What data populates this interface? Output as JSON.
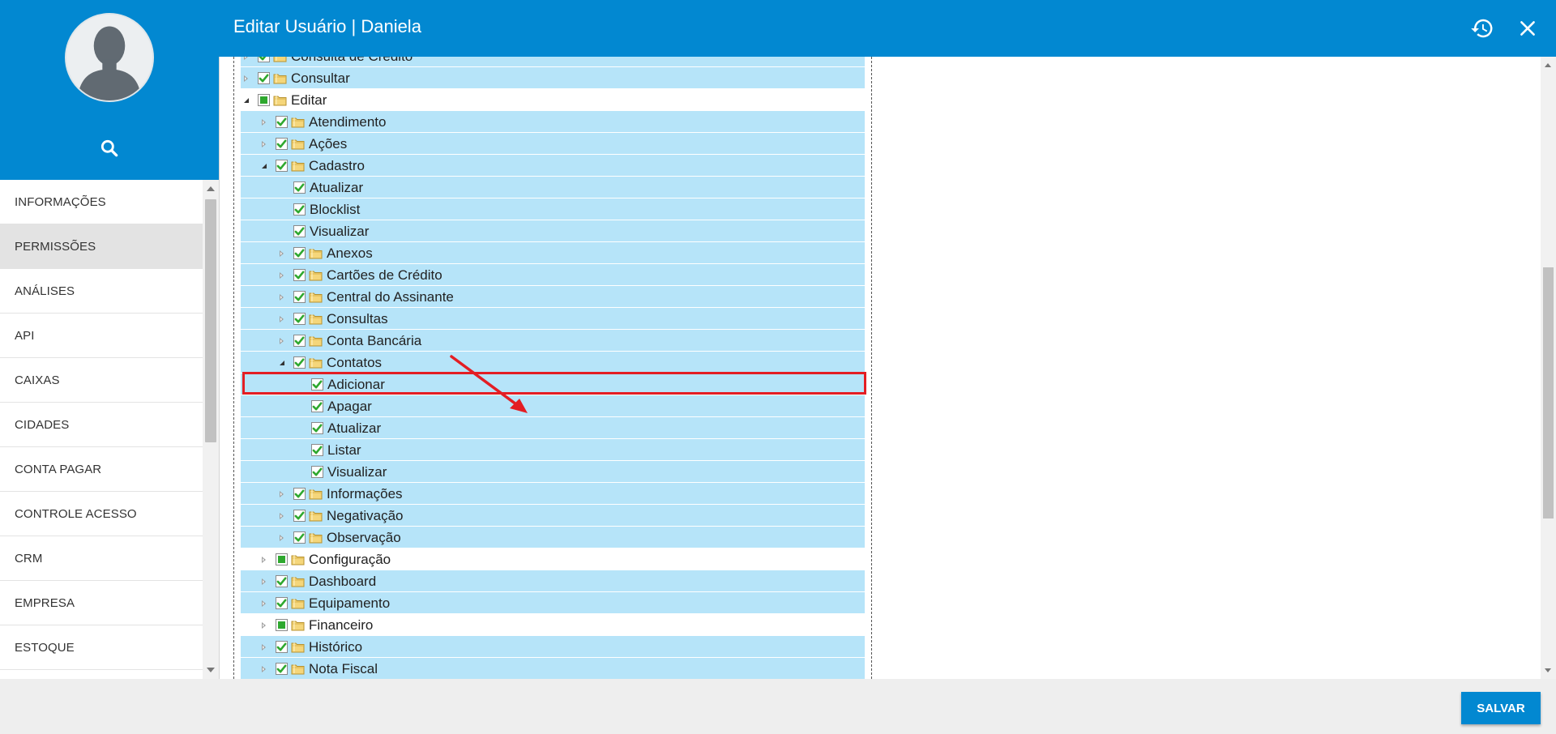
{
  "header": {
    "title": "Editar Usuário | Daniela"
  },
  "sidebar": {
    "items": [
      {
        "label": "INFORMAÇÕES",
        "active": false
      },
      {
        "label": "PERMISSÕES",
        "active": true
      },
      {
        "label": "ANÁLISES",
        "active": false
      },
      {
        "label": "API",
        "active": false
      },
      {
        "label": "CAIXAS",
        "active": false
      },
      {
        "label": "CIDADES",
        "active": false
      },
      {
        "label": "CONTA PAGAR",
        "active": false
      },
      {
        "label": "CONTROLE ACESSO",
        "active": false
      },
      {
        "label": "CRM",
        "active": false
      },
      {
        "label": "EMPRESA",
        "active": false
      },
      {
        "label": "ESTOQUE",
        "active": false
      }
    ]
  },
  "tree": [
    {
      "label": "Consulta de Crédito",
      "level": 1,
      "toggle": "collapsed",
      "check": "checked",
      "folder": true,
      "selected": true
    },
    {
      "label": "Consultar",
      "level": 1,
      "toggle": "collapsed",
      "check": "checked",
      "folder": true,
      "selected": true
    },
    {
      "label": "Editar",
      "level": 1,
      "toggle": "expanded",
      "check": "partial",
      "folder": true,
      "selected": false
    },
    {
      "label": "Atendimento",
      "level": 2,
      "toggle": "collapsed",
      "check": "checked",
      "folder": true,
      "selected": true
    },
    {
      "label": "Ações",
      "level": 2,
      "toggle": "collapsed",
      "check": "checked",
      "folder": true,
      "selected": true
    },
    {
      "label": "Cadastro",
      "level": 2,
      "toggle": "expanded",
      "check": "checked",
      "folder": true,
      "selected": true
    },
    {
      "label": "Atualizar",
      "level": 3,
      "toggle": "none",
      "check": "checked",
      "folder": false,
      "selected": true
    },
    {
      "label": "Blocklist",
      "level": 3,
      "toggle": "none",
      "check": "checked",
      "folder": false,
      "selected": true
    },
    {
      "label": "Visualizar",
      "level": 3,
      "toggle": "none",
      "check": "checked",
      "folder": false,
      "selected": true
    },
    {
      "label": "Anexos",
      "level": 3,
      "toggle": "collapsed",
      "check": "checked",
      "folder": true,
      "selected": true
    },
    {
      "label": "Cartões de Crédito",
      "level": 3,
      "toggle": "collapsed",
      "check": "checked",
      "folder": true,
      "selected": true
    },
    {
      "label": "Central do Assinante",
      "level": 3,
      "toggle": "collapsed",
      "check": "checked",
      "folder": true,
      "selected": true
    },
    {
      "label": "Consultas",
      "level": 3,
      "toggle": "collapsed",
      "check": "checked",
      "folder": true,
      "selected": true
    },
    {
      "label": "Conta Bancária",
      "level": 3,
      "toggle": "collapsed",
      "check": "checked",
      "folder": true,
      "selected": true
    },
    {
      "label": "Contatos",
      "level": 3,
      "toggle": "expanded",
      "check": "checked",
      "folder": true,
      "selected": true
    },
    {
      "label": "Adicionar",
      "level": 4,
      "toggle": "none",
      "check": "checked",
      "folder": false,
      "selected": true,
      "highlighted": true
    },
    {
      "label": "Apagar",
      "level": 4,
      "toggle": "none",
      "check": "checked",
      "folder": false,
      "selected": true
    },
    {
      "label": "Atualizar",
      "level": 4,
      "toggle": "none",
      "check": "checked",
      "folder": false,
      "selected": true
    },
    {
      "label": "Listar",
      "level": 4,
      "toggle": "none",
      "check": "checked",
      "folder": false,
      "selected": true
    },
    {
      "label": "Visualizar",
      "level": 4,
      "toggle": "none",
      "check": "checked",
      "folder": false,
      "selected": true
    },
    {
      "label": "Informações",
      "level": 3,
      "toggle": "collapsed",
      "check": "checked",
      "folder": true,
      "selected": true
    },
    {
      "label": "Negativação",
      "level": 3,
      "toggle": "collapsed",
      "check": "checked",
      "folder": true,
      "selected": true
    },
    {
      "label": "Observação",
      "level": 3,
      "toggle": "collapsed",
      "check": "checked",
      "folder": true,
      "selected": true
    },
    {
      "label": "Configuração",
      "level": 2,
      "toggle": "collapsed",
      "check": "partial",
      "folder": true,
      "selected": false
    },
    {
      "label": "Dashboard",
      "level": 2,
      "toggle": "collapsed",
      "check": "checked",
      "folder": true,
      "selected": true
    },
    {
      "label": "Equipamento",
      "level": 2,
      "toggle": "collapsed",
      "check": "checked",
      "folder": true,
      "selected": true
    },
    {
      "label": "Financeiro",
      "level": 2,
      "toggle": "collapsed",
      "check": "partial",
      "folder": true,
      "selected": false
    },
    {
      "label": "Histórico",
      "level": 2,
      "toggle": "collapsed",
      "check": "checked",
      "folder": true,
      "selected": true
    },
    {
      "label": "Nota Fiscal",
      "level": 2,
      "toggle": "collapsed",
      "check": "checked",
      "folder": true,
      "selected": true
    }
  ],
  "footer": {
    "save_label": "SALVAR"
  },
  "icons": {
    "search": "search-icon",
    "history": "history-icon",
    "close": "close-icon",
    "folder": "folder-icon",
    "checkbox": "checkbox-icon",
    "avatar": "avatar-icon"
  },
  "colors": {
    "primary": "#0288d1",
    "row_selected": "#b6e4f9",
    "check_green": "#2fa82f",
    "highlight_red": "#e31e24",
    "footer_bg": "#eeeeee"
  }
}
